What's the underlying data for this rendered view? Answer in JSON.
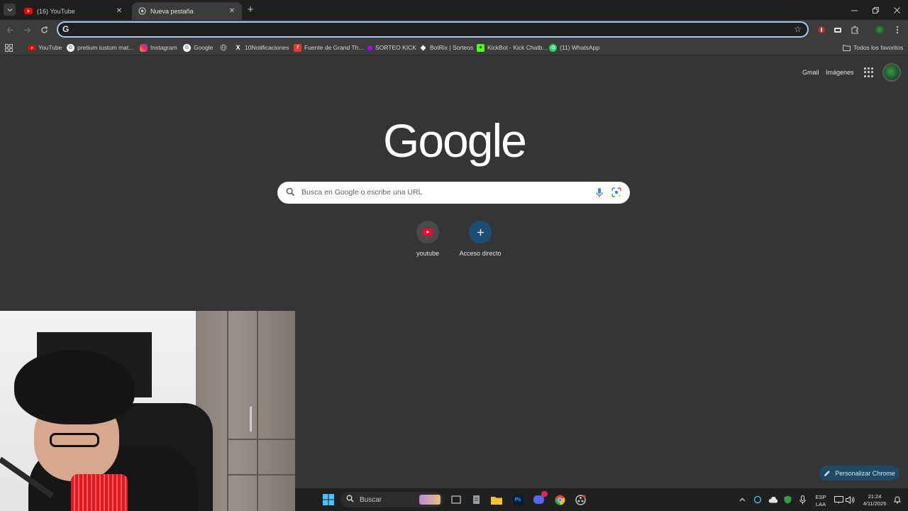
{
  "tabs": [
    {
      "label": "(16) YouTube",
      "icon": "youtube-icon"
    },
    {
      "label": "Nueva pestaña",
      "icon": "chrome-newtab-icon"
    }
  ],
  "omnibox": {
    "value": "",
    "placeholder": ""
  },
  "bookmarks": [
    {
      "label": "YouTube",
      "icon": "youtube-icon",
      "color": "#ff0000"
    },
    {
      "label": "pretium iustum mat...",
      "icon": "google-icon",
      "color": "#4285f4"
    },
    {
      "label": "Instagram",
      "icon": "instagram-icon",
      "color": "#e1306c"
    },
    {
      "label": "Google",
      "icon": "google-icon",
      "color": "#4285f4"
    },
    {
      "label": "",
      "icon": "globe-icon",
      "color": "#9aa0a6"
    },
    {
      "label": "10Notificaciones",
      "icon": "x-icon",
      "color": "#ffffff"
    },
    {
      "label": "Fuente de Grand Th...",
      "icon": "font-icon",
      "color": "#e53935"
    },
    {
      "label": "SORTEO KICK",
      "icon": "kick-icon",
      "color": "#b000ff"
    },
    {
      "label": "BotRix | Sorteos",
      "icon": "botrix-icon",
      "color": "#ffffff"
    },
    {
      "label": "KickBot - Kick Chatb...",
      "icon": "kickbot-icon",
      "color": "#53fc18"
    },
    {
      "label": "(11) WhatsApp",
      "icon": "whatsapp-icon",
      "color": "#25d366"
    }
  ],
  "all_bookmarks_label": "Todos los favoritos",
  "ntp": {
    "gmail": "Gmail",
    "images": "Imágenes",
    "logo_text": "Google",
    "search_placeholder": "Busca en Google o escribe una URL",
    "shortcuts": [
      {
        "label": "youtube",
        "icon": "youtube-icon"
      },
      {
        "label": "Acceso directo",
        "icon": "plus-icon"
      }
    ],
    "customize_label": "Personalizar Chrome"
  },
  "taskbar": {
    "search_label": "Buscar",
    "lang_top": "ESP",
    "lang_bottom": "LAA",
    "time": "21:24",
    "date": "4/11/2025"
  },
  "colors": {
    "accent": "#a8c7fa",
    "page_bg": "#353535",
    "toolbar_bg": "#3c3c3c"
  }
}
